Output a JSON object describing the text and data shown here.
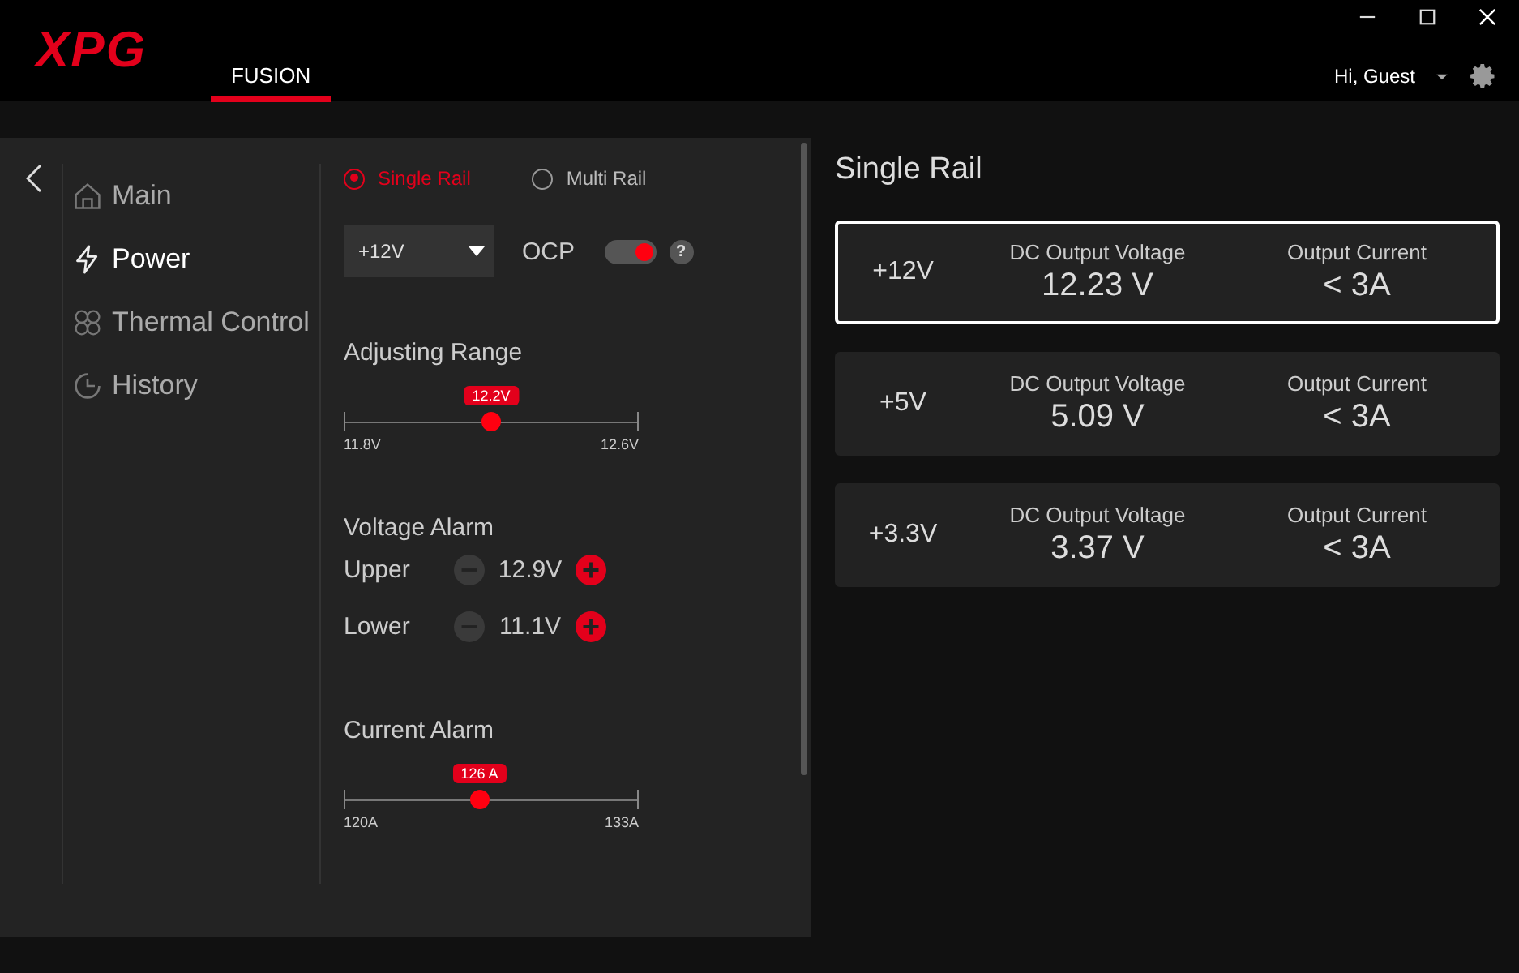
{
  "app": {
    "logo": "XPG",
    "greeting": "Hi, Guest"
  },
  "tabs": [
    {
      "label": "FUSION",
      "selected": true
    }
  ],
  "nav": [
    {
      "label": "Main",
      "selected": false
    },
    {
      "label": "Power",
      "selected": true
    },
    {
      "label": "Thermal Control",
      "selected": false
    },
    {
      "label": "History",
      "selected": false
    }
  ],
  "rail_options": [
    {
      "label": "Single Rail",
      "selected": true
    },
    {
      "label": "Multi Rail",
      "selected": false
    }
  ],
  "rail_select": {
    "value": "+12V"
  },
  "ocp": {
    "label": "OCP",
    "on": true,
    "help": "?"
  },
  "adjusting_range": {
    "title": "Adjusting Range",
    "level": 0.5,
    "reading": "12.2V",
    "min": "11.8V",
    "max": "12.6V"
  },
  "voltage_alarm": {
    "title": "Voltage Alarm",
    "rows": [
      {
        "label": "Upper",
        "value": "12.9V"
      },
      {
        "label": "Lower",
        "value": "11.1V"
      }
    ]
  },
  "current_alarm": {
    "title": "Current Alarm",
    "level": 0.46,
    "reading": "126 A",
    "min": "120A",
    "max": "133A"
  },
  "summary": {
    "title": "Single Rail",
    "rails": [
      {
        "name": "+12V",
        "selected": true,
        "voltage_label": "DC Output Voltage",
        "voltage": "12.23 V",
        "current_label": "Output Current",
        "current": "< 3A"
      },
      {
        "name": "+5V",
        "selected": false,
        "voltage_label": "DC Output Voltage",
        "voltage": "5.09 V",
        "current_label": "Output Current",
        "current": "< 3A"
      },
      {
        "name": "+3.3V",
        "selected": false,
        "voltage_label": "DC Output Voltage",
        "voltage": "3.37 V",
        "current_label": "Output Current",
        "current": "< 3A"
      }
    ]
  }
}
